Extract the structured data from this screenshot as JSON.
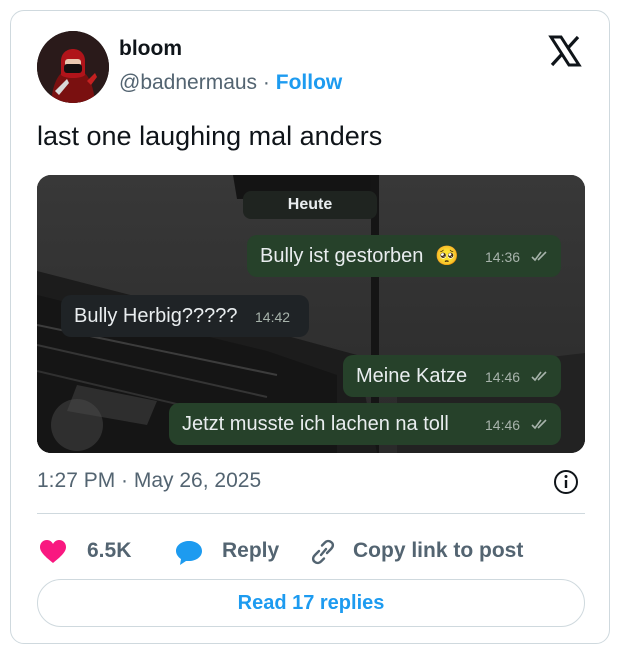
{
  "author": {
    "display_name": "bloom",
    "handle": "@badnermaus",
    "separator": "·",
    "follow_label": "Follow",
    "brand_icon": "x-logo-icon"
  },
  "tweet": {
    "text": "last one laughing mal anders",
    "timestamp": "1:27 PM · May 26, 2025"
  },
  "chat": {
    "day_label": "Heute",
    "messages": [
      {
        "direction": "outgoing",
        "text": "Bully ist gestorben",
        "emoji": "🥺",
        "time": "14:36"
      },
      {
        "direction": "incoming",
        "text": "Bully Herbig?????",
        "time": "14:42"
      },
      {
        "direction": "outgoing",
        "text": "Meine Katze",
        "time": "14:46"
      },
      {
        "direction": "outgoing",
        "text": "Jetzt musste ich lachen na toll",
        "time": "14:46"
      }
    ]
  },
  "actions": {
    "like_count": "6.5K",
    "reply_label": "Reply",
    "copy_label": "Copy link to post",
    "read_replies_label": "Read 17 replies"
  },
  "colors": {
    "accent": "#1d9bf0",
    "like": "#f91880",
    "outgoing_bubble": "#26412a",
    "incoming_bubble": "#1f2326",
    "secondary_text": "#536471"
  }
}
